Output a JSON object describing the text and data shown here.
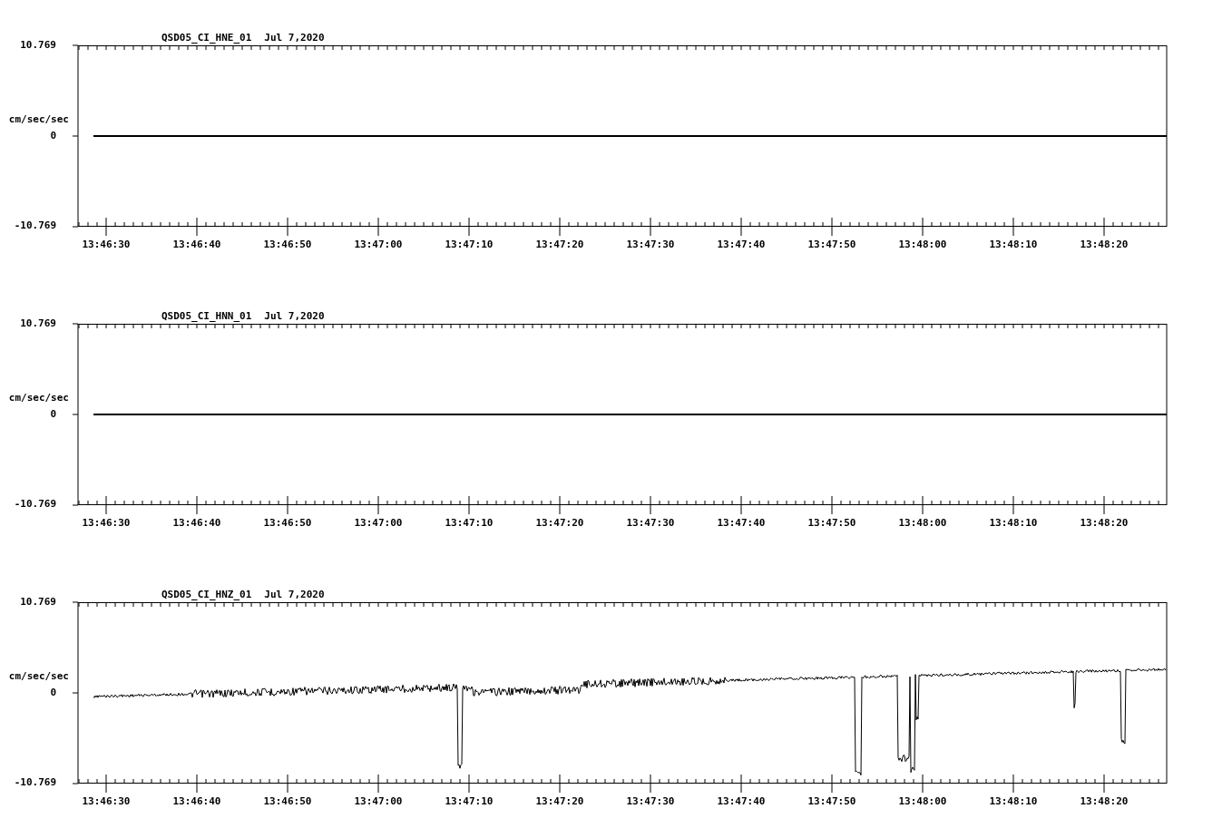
{
  "panels": [
    {
      "kind": "flat",
      "title": "QSD05_CI_HNE_01",
      "date": "Jul 7,2020",
      "y_max": "10.769",
      "unit": "cm/sec/sec",
      "y_zero": "0",
      "y_min": "-10.769",
      "x_ticks": [
        "13:46:30",
        "13:46:40",
        "13:46:50",
        "13:47:00",
        "13:47:10",
        "13:47:20",
        "13:47:30",
        "13:47:40",
        "13:47:50",
        "13:48:00",
        "13:48:10",
        "13:48:20"
      ]
    },
    {
      "kind": "flat",
      "title": "QSD05_CI_HNN_01",
      "date": "Jul 7,2020",
      "y_max": "10.769",
      "unit": "cm/sec/sec",
      "y_zero": "0",
      "y_min": "-10.769",
      "x_ticks": [
        "13:46:30",
        "13:46:40",
        "13:46:50",
        "13:47:00",
        "13:47:10",
        "13:47:20",
        "13:47:30",
        "13:47:40",
        "13:47:50",
        "13:48:00",
        "13:48:10",
        "13:48:20"
      ]
    },
    {
      "kind": "noisy",
      "title": "QSD05_CI_HNZ_01",
      "date": "Jul 7,2020",
      "y_max": "10.769",
      "unit": "cm/sec/sec",
      "y_zero": "0",
      "y_min": "-10.769",
      "x_ticks": [
        "13:46:30",
        "13:46:40",
        "13:46:50",
        "13:47:00",
        "13:47:10",
        "13:47:20",
        "13:47:30",
        "13:47:40",
        "13:47:50",
        "13:48:00",
        "13:48:10",
        "13:48:20"
      ]
    }
  ]
}
